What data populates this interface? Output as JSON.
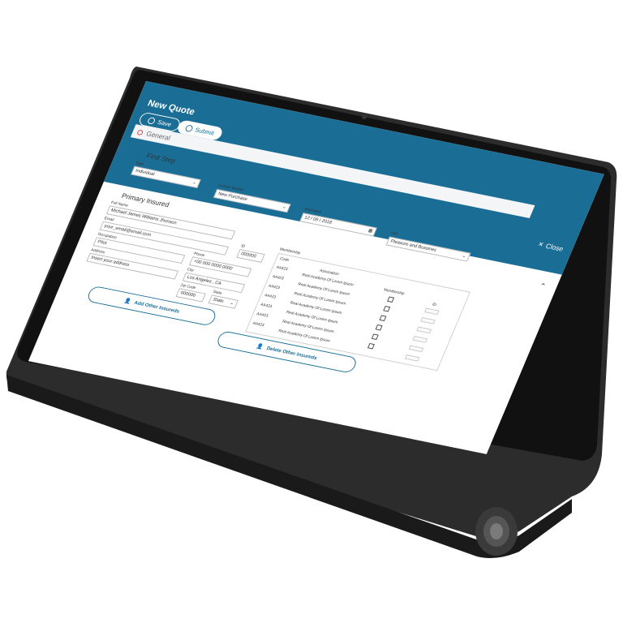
{
  "header": {
    "title": "New Quote",
    "save_label": "Save",
    "submit_label": "Submit",
    "close_label": "Close",
    "accent": "#1a6e96"
  },
  "general_tab": "General",
  "first_step": {
    "heading": "First Step",
    "type_label": "Type",
    "type_value": "Individual",
    "current_market_label": "Current Market",
    "current_market_value": "New Purchase",
    "expiration_label": "Expiration",
    "expiration_value": "12 / 09 / 2018",
    "use_label": "Use",
    "use_value": "Pleasure and Bussines"
  },
  "primary_insured": {
    "heading": "Primary Insured",
    "full_name_label": "Full Name",
    "full_name_value": "Michael James Williams Jhonson",
    "email_label": "Email",
    "email_value": "your_email@email.com",
    "occupation_label": "Occupation",
    "occupation_value": "Pilot",
    "address_label": "Address",
    "address_value": "Insert your address",
    "phone_label": "Phone",
    "phone_value": "+00 000 0000 0000",
    "city_label": "City",
    "city_value": "Los Angeles , CA",
    "zip_label": "Zip Code",
    "zip_value": "000000",
    "state_label": "State",
    "state_value": "State",
    "id_label": "ID",
    "id_value": "000000"
  },
  "membership": {
    "heading": "Membership",
    "columns": [
      "Code",
      "Association",
      "Membership",
      "ID"
    ],
    "rows": [
      {
        "code": "AA423",
        "association": "Real Academy Of Lorem Ipsum"
      },
      {
        "code": "AA423",
        "association": "Real Academy Of Lorem Ipsum"
      },
      {
        "code": "AA423",
        "association": "Real Academy Of Lorem Ipsum"
      },
      {
        "code": "AA423",
        "association": "Real Academy Of Lorem Ipsum"
      },
      {
        "code": "AA423",
        "association": "Real Academy Of Lorem Ipsum"
      },
      {
        "code": "AA423",
        "association": "Real Academy Of Lorem Ipsum"
      },
      {
        "code": "AA423",
        "association": "Real Academy Of Lorem Ipsum"
      }
    ]
  },
  "actions": {
    "add_label": "Add Other Insureds",
    "delete_label": "Delete Other Insureds"
  }
}
